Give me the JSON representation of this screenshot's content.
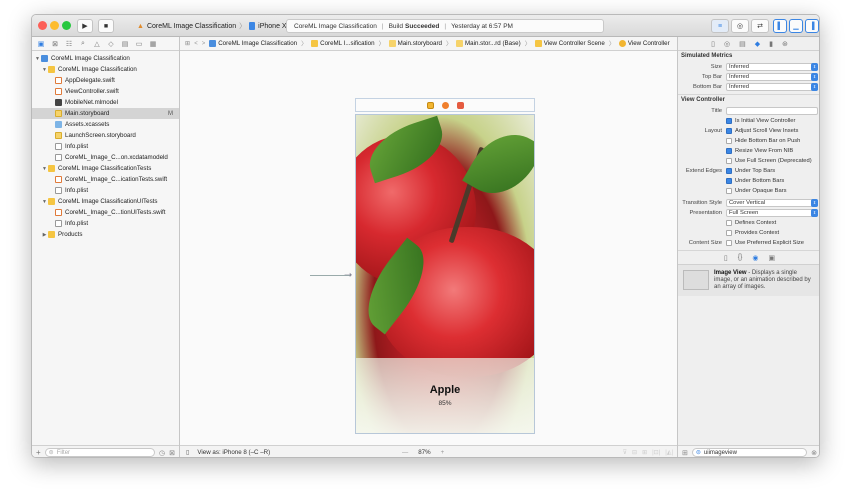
{
  "toolbar": {
    "scheme_name": "CoreML Image Classification",
    "device": "iPhone X",
    "status_project": "CoreML Image Classification",
    "status_build": "Build",
    "status_result": "Succeeded",
    "status_time": "Yesterday at 6:57 PM"
  },
  "navigator": {
    "items": [
      {
        "label": "CoreML Image Classification",
        "kind": "proj"
      },
      {
        "label": "CoreML Image Classification",
        "kind": "folder"
      },
      {
        "label": "AppDelegate.swift",
        "kind": "swift"
      },
      {
        "label": "ViewController.swift",
        "kind": "swift"
      },
      {
        "label": "MobileNet.mlmodel",
        "kind": "model"
      },
      {
        "label": "Main.storyboard",
        "kind": "sb",
        "mark": "M"
      },
      {
        "label": "Assets.xcassets",
        "kind": "assets"
      },
      {
        "label": "LaunchScreen.storyboard",
        "kind": "sb"
      },
      {
        "label": "Info.plist",
        "kind": "plist"
      },
      {
        "label": "CoreML_Image_C...on.xcdatamodeld",
        "kind": "plist"
      },
      {
        "label": "CoreML Image ClassificationTests",
        "kind": "folder"
      },
      {
        "label": "CoreML_Image_C...icationTests.swift",
        "kind": "swift"
      },
      {
        "label": "Info.plist",
        "kind": "plist"
      },
      {
        "label": "CoreML Image ClassificationUITests",
        "kind": "folder"
      },
      {
        "label": "CoreML_Image_C...tionUITests.swift",
        "kind": "swift"
      },
      {
        "label": "Info.plist",
        "kind": "plist"
      },
      {
        "label": "Products",
        "kind": "folder"
      }
    ],
    "filter_placeholder": "Filter"
  },
  "jumpbar": {
    "crumbs": [
      "CoreML Image Classification",
      "CoreML I...sification",
      "Main.storyboard",
      "Main.stor...rd (Base)",
      "View Controller Scene",
      "View Controller"
    ]
  },
  "scene": {
    "prediction_label": "Apple",
    "confidence_label": "85%"
  },
  "editor_footer": {
    "view_as": "View as: iPhone 8 (–C –R)",
    "zoom_out": "—",
    "zoom": "87%",
    "zoom_in": "+"
  },
  "inspector": {
    "simulated_metrics_title": "Simulated Metrics",
    "size_label": "Size",
    "size_value": "Inferred",
    "topbar_label": "Top Bar",
    "topbar_value": "Inferred",
    "bottombar_label": "Bottom Bar",
    "bottombar_value": "Inferred",
    "vc_title": "View Controller",
    "title_label": "Title",
    "initial_vc": "Is Initial View Controller",
    "layout_label": "Layout",
    "adjust_scroll": "Adjust Scroll View Insets",
    "hide_bottom": "Hide Bottom Bar on Push",
    "resize_nib": "Resize View From NIB",
    "full_screen": "Use Full Screen (Deprecated)",
    "extend_edges_label": "Extend Edges",
    "under_top": "Under Top Bars",
    "under_bottom": "Under Bottom Bars",
    "under_opaque": "Under Opaque Bars",
    "transition_label": "Transition Style",
    "transition_value": "Cover Vertical",
    "presentation_label": "Presentation",
    "presentation_value": "Full Screen",
    "defines_context": "Defines Context",
    "provides_context": "Provides Context",
    "content_size_label": "Content Size",
    "preferred_size": "Use Preferred Explicit Size",
    "library_item_title": "Image View",
    "library_item_desc": " - Displays a single image, or an animation described by an array of images.",
    "search_value": "uiimageview"
  }
}
